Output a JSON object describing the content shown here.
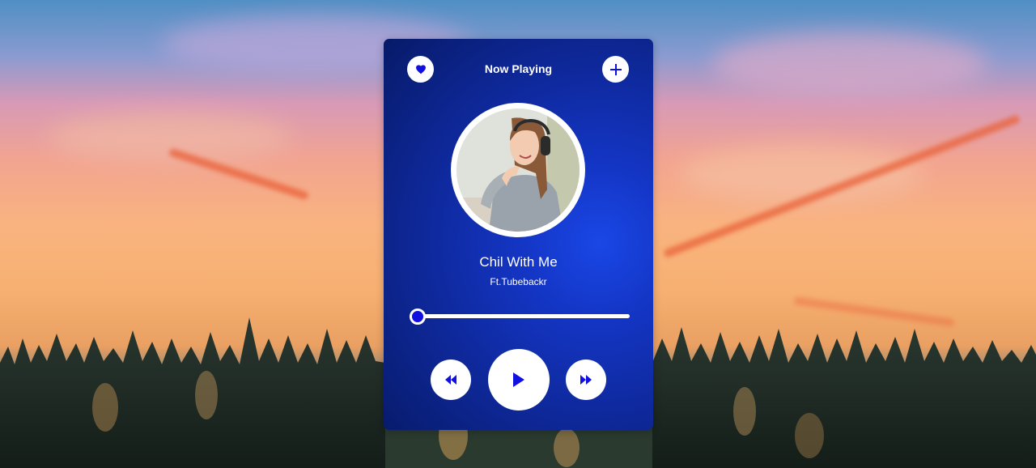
{
  "header": {
    "title": "Now Playing",
    "favorite_icon": "heart-icon",
    "add_icon": "plus-icon"
  },
  "track": {
    "title": "Chil With Me",
    "artist": "Ft.Tubebackr"
  },
  "progress": {
    "value": 0
  },
  "controls": {
    "rewind_icon": "rewind-icon",
    "play_icon": "play-icon",
    "forward_icon": "fast-forward-icon"
  },
  "colors": {
    "accent": "#1010e0",
    "card_dark": "#071a68",
    "card_light": "#1a47e6",
    "white": "#ffffff"
  }
}
